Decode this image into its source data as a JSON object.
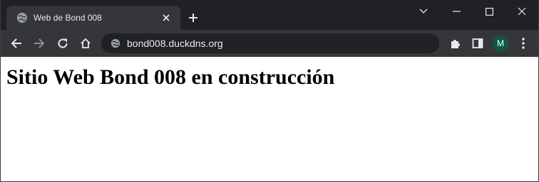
{
  "browser": {
    "tab": {
      "title": "Web de Bond 008"
    },
    "address_bar": {
      "url": "bond008.duckdns.org"
    },
    "profile": {
      "initial": "M"
    },
    "icons": {
      "favicon": "globe-icon",
      "close_tab": "close-icon",
      "new_tab": "plus-icon",
      "tab_search": "chevron-down-icon",
      "minimize": "minimize-icon",
      "maximize": "maximize-icon",
      "close_window": "close-icon",
      "back": "arrow-left-icon",
      "forward": "arrow-right-icon",
      "reload": "reload-icon",
      "home": "home-icon",
      "site_info": "globe-icon",
      "extensions": "puzzle-icon",
      "side_panel": "side-panel-icon",
      "menu": "kebab-menu-icon"
    },
    "colors": {
      "titlebar_bg": "#202124",
      "toolbar_bg": "#35363a",
      "omnibox_bg": "#202124",
      "avatar_bg": "#0b5a46"
    }
  },
  "page": {
    "heading": "Sitio Web Bond 008 en construcción"
  }
}
